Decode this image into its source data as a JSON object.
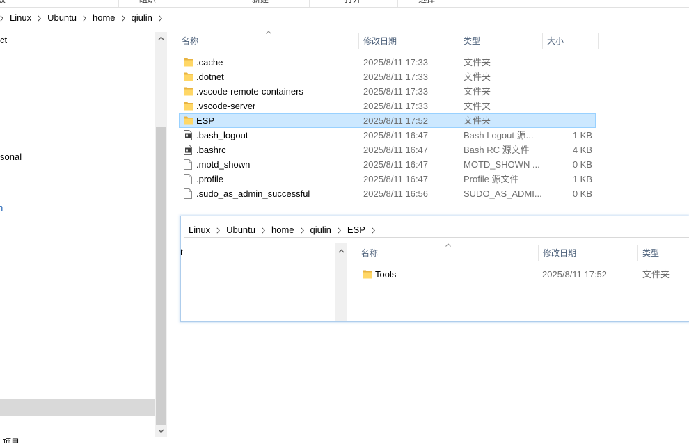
{
  "ribbon": {
    "groups": [
      "板",
      "组织",
      "新建",
      "打开",
      "选择"
    ]
  },
  "address": {
    "crumbs": [
      "Linux",
      "Ubuntu",
      "home",
      "qiulin"
    ]
  },
  "nav": {
    "items": [
      "ct",
      "sonal",
      "n"
    ]
  },
  "columns": {
    "name": "名称",
    "date": "修改日期",
    "type": "类型",
    "size": "大小"
  },
  "files": [
    {
      "name": ".cache",
      "date": "2025/8/11 17:33",
      "type": "文件夹",
      "size": "",
      "icon": "folder-icon"
    },
    {
      "name": ".dotnet",
      "date": "2025/8/11 17:33",
      "type": "文件夹",
      "size": "",
      "icon": "folder-icon"
    },
    {
      "name": ".vscode-remote-containers",
      "date": "2025/8/11 17:33",
      "type": "文件夹",
      "size": "",
      "icon": "folder-icon"
    },
    {
      "name": ".vscode-server",
      "date": "2025/8/11 17:33",
      "type": "文件夹",
      "size": "",
      "icon": "folder-icon"
    },
    {
      "name": "ESP",
      "date": "2025/8/11 17:52",
      "type": "文件夹",
      "size": "",
      "icon": "folder-icon",
      "selected": true
    },
    {
      "name": ".bash_logout",
      "date": "2025/8/11 16:47",
      "type": "Bash Logout 源...",
      "size": "1 KB",
      "icon": "shell-file-icon"
    },
    {
      "name": ".bashrc",
      "date": "2025/8/11 16:47",
      "type": "Bash RC 源文件",
      "size": "4 KB",
      "icon": "shell-file-icon"
    },
    {
      "name": ".motd_shown",
      "date": "2025/8/11 16:47",
      "type": "MOTD_SHOWN ...",
      "size": "0 KB",
      "icon": "file-icon"
    },
    {
      "name": ".profile",
      "date": "2025/8/11 16:47",
      "type": "Profile 源文件",
      "size": "1 KB",
      "icon": "file-icon"
    },
    {
      "name": ".sudo_as_admin_successful",
      "date": "2025/8/11 16:56",
      "type": "SUDO_AS_ADMI...",
      "size": "0 KB",
      "icon": "file-icon"
    }
  ],
  "status": {
    "text": "项目"
  },
  "preview": {
    "address": {
      "crumbs": [
        "Linux",
        "Ubuntu",
        "home",
        "qiulin",
        "ESP"
      ]
    },
    "nav": {
      "items": [
        "t"
      ]
    },
    "columns": {
      "name": "名称",
      "date": "修改日期",
      "type": "类型"
    },
    "files": [
      {
        "name": "Tools",
        "date": "2025/8/11 17:52",
        "type": "文件夹",
        "icon": "folder-icon"
      }
    ]
  },
  "icons": {
    "breadcrumb_separator": "chevron-right-icon",
    "sort": "sort-up-icon",
    "scroll_up": "chevron-up-icon",
    "scroll_down": "chevron-down-icon"
  },
  "colors": {
    "selection_bg": "#cce8ff",
    "selection_border": "#99d1ff",
    "folder_front": "#ffd766",
    "folder_back": "#e8b442",
    "nav_link": "#1a5fb4",
    "header_text": "#4c607a"
  }
}
